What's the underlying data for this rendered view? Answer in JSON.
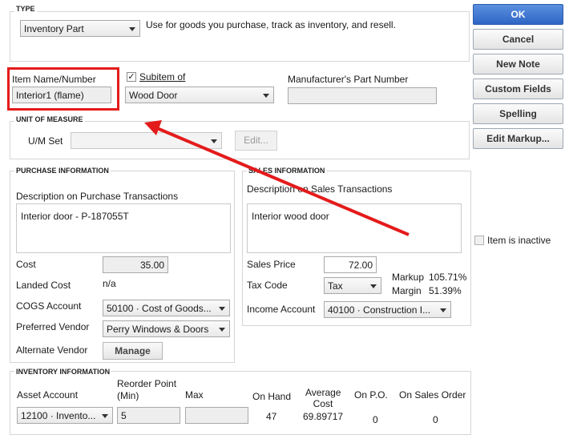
{
  "type_section": {
    "title": "TYPE",
    "selected": "Inventory Part",
    "description": "Use for goods you purchase, track as inventory, and resell."
  },
  "item": {
    "name_label": "Item Name/Number",
    "name_value": "Interior1 (flame)",
    "subitem_label": "Subitem of",
    "subitem_checked": true,
    "subitem_check_glyph": "✓",
    "subitem_value": "Wood Door",
    "mpn_label": "Manufacturer's Part Number",
    "mpn_value": ""
  },
  "uom": {
    "title": "UNIT OF MEASURE",
    "set_label": "U/M Set",
    "set_value": "",
    "edit_label": "Edit..."
  },
  "purchase": {
    "title": "PURCHASE INFORMATION",
    "desc_label": "Description on Purchase Transactions",
    "desc_value": "Interior door - P-187055T",
    "cost_label": "Cost",
    "cost_value": "35.00",
    "landed_label": "Landed Cost",
    "landed_value": "n/a",
    "cogs_label": "COGS Account",
    "cogs_value": "50100 · Cost of Goods...",
    "vendor_label": "Preferred Vendor",
    "vendor_value": "Perry Windows & Doors",
    "alt_vendor_label": "Alternate Vendor",
    "manage_label": "Manage"
  },
  "sales": {
    "title": "SALES INFORMATION",
    "desc_label": "Description on Sales Transactions",
    "desc_value": "Interior wood door",
    "price_label": "Sales Price",
    "price_value": "72.00",
    "tax_label": "Tax Code",
    "tax_value": "Tax",
    "markup_label": "Markup",
    "markup_value": "105.71%",
    "margin_label": "Margin",
    "margin_value": "51.39%",
    "income_label": "Income Account",
    "income_value": "40100 · Construction I..."
  },
  "inventory": {
    "title": "INVENTORY INFORMATION",
    "asset_label": "Asset Account",
    "asset_value": "12100 · Invento...",
    "reorder_label_1": "Reorder Point",
    "reorder_label_2": "(Min)",
    "reorder_value": "5",
    "max_label": "Max",
    "max_value": "",
    "onhand_label": "On Hand",
    "onhand_value": "47",
    "avgcost_label_1": "Average",
    "avgcost_label_2": "Cost",
    "avgcost_value": "69.89717",
    "onpo_label": "On P.O.",
    "onpo_value": "0",
    "onso_label": "On Sales Order",
    "onso_value": "0"
  },
  "buttons": {
    "ok": "OK",
    "cancel": "Cancel",
    "new_note": "New Note",
    "custom_fields": "Custom Fields",
    "spelling": "Spelling",
    "edit_markup": "Edit Markup..."
  },
  "inactive_label": "Item is inactive",
  "colors": {
    "annotation": "#e41b1b",
    "ok_button": "#3a73d0"
  }
}
